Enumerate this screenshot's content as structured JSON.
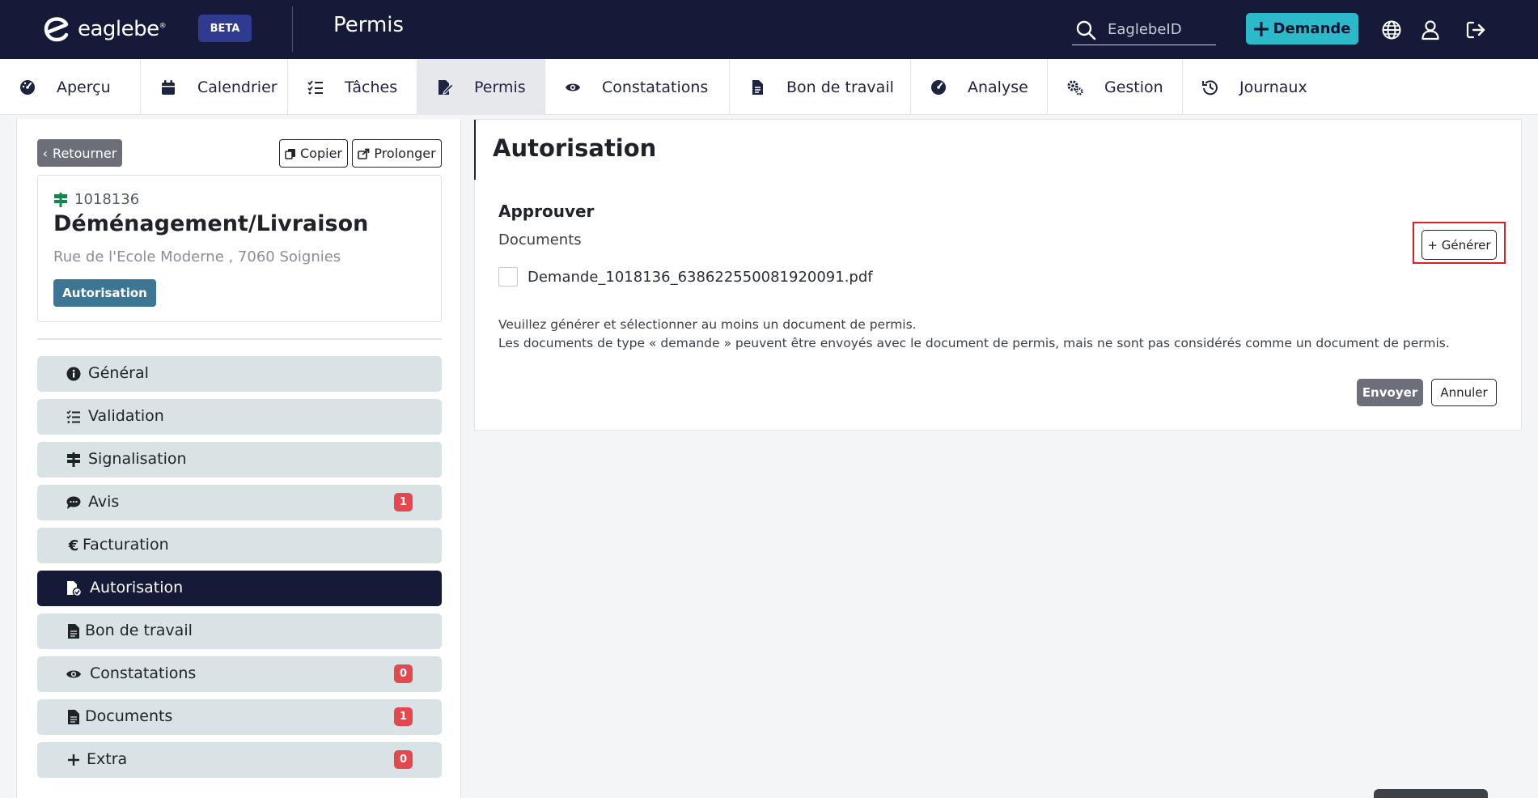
{
  "brand": {
    "logo_text": "eaglebe",
    "beta": "BETA"
  },
  "header": {
    "title": "Permis",
    "search_placeholder": "EaglebeID",
    "new_request_label": "Demande"
  },
  "nav": {
    "tabs": [
      {
        "label": "Aperçu",
        "icon": "gauge-icon"
      },
      {
        "label": "Calendrier",
        "icon": "calendar-icon"
      },
      {
        "label": "Tâches",
        "icon": "tasks-icon"
      },
      {
        "label": "Permis",
        "icon": "permit-icon",
        "active": true
      },
      {
        "label": "Constatations",
        "icon": "eye-icon"
      },
      {
        "label": "Bon de travail",
        "icon": "document-icon"
      },
      {
        "label": "Analyse",
        "icon": "gauge-icon"
      },
      {
        "label": "Gestion",
        "icon": "gears-icon"
      },
      {
        "label": "Journaux",
        "icon": "history-icon"
      }
    ]
  },
  "left": {
    "back_label": "Retourner",
    "copy_label": "Copier",
    "extend_label": "Prolonger",
    "card": {
      "id": "1018136",
      "title": "Déménagement/Livraison",
      "address": "Rue de l'Ecole Moderne , 7060 Soignies",
      "status": "Autorisation"
    },
    "menu": [
      {
        "label": "Général",
        "icon": "info-icon"
      },
      {
        "label": "Validation",
        "icon": "checklist-icon"
      },
      {
        "label": "Signalisation",
        "icon": "signpost-icon"
      },
      {
        "label": "Avis",
        "icon": "comments-icon",
        "badge": "1"
      },
      {
        "label": "Facturation",
        "icon": "euro-icon"
      },
      {
        "label": "Autorisation",
        "icon": "file-check-icon",
        "active": true
      },
      {
        "label": "Bon de travail",
        "icon": "document-icon"
      },
      {
        "label": "Constatations",
        "icon": "eye-icon",
        "badge": "0"
      },
      {
        "label": "Documents",
        "icon": "document-icon",
        "badge": "1"
      },
      {
        "label": "Extra",
        "icon": "plus-icon",
        "badge": "0"
      }
    ]
  },
  "main": {
    "title": "Autorisation",
    "section_title": "Approuver",
    "documents_label": "Documents",
    "generate_label": "+ Générer",
    "document": {
      "name": "Demande_1018136_638622550081920091.pdf",
      "checked": false
    },
    "note_line1": "Veuillez générer et sélectionner au moins un document de permis.",
    "note_line2": "Les documents de type « demande » peuvent être envoyés avec le document de permis, mais ne sont pas considérés comme un document de permis.",
    "send_label": "Envoyer",
    "cancel_label": "Annuler"
  },
  "colors": {
    "topbar": "#141a38",
    "accent": "#2cb9c9",
    "badge": "#e4484f",
    "status": "#3d7595",
    "highlight": "#dc1f26"
  }
}
